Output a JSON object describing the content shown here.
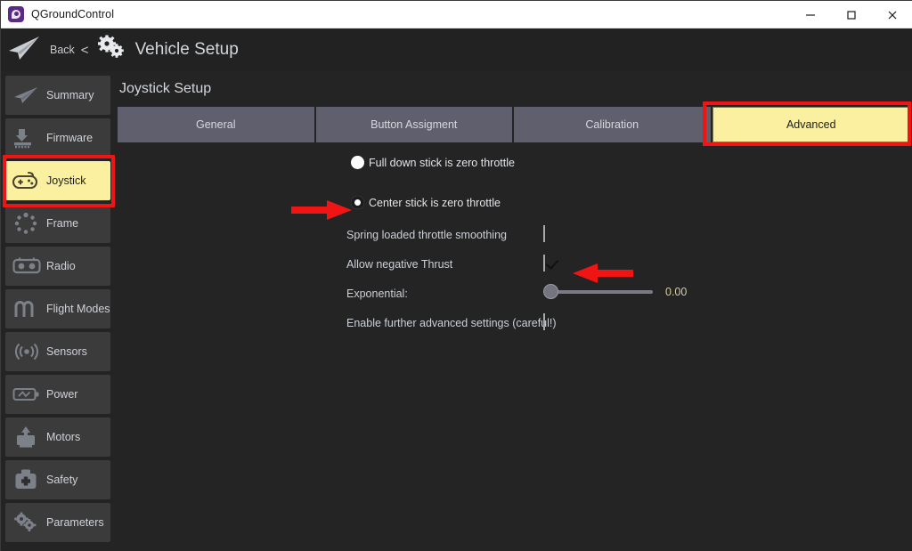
{
  "window": {
    "title": "QGroundControl",
    "logo_icon": "qgroundcontrol-logo-icon",
    "minimize_label": "minimize-icon",
    "maximize_label": "maximize-icon",
    "close_label": "close-icon"
  },
  "header": {
    "plane_icon": "paper-plane-icon",
    "back_label": "Back",
    "chevron": "<",
    "gears_icon": "gears-icon",
    "title": "Vehicle Setup"
  },
  "sidebar": {
    "items": [
      {
        "label": "Summary",
        "icon": "paper-plane-icon",
        "active": false
      },
      {
        "label": "Firmware",
        "icon": "download-chip-icon",
        "active": false
      },
      {
        "label": "Joystick",
        "icon": "gamepad-icon",
        "active": true
      },
      {
        "label": "Frame",
        "icon": "frame-dots-icon",
        "active": false
      },
      {
        "label": "Radio",
        "icon": "radio-controller-icon",
        "active": false
      },
      {
        "label": "Flight Modes",
        "icon": "waveform-icon",
        "active": false
      },
      {
        "label": "Sensors",
        "icon": "sensor-waves-icon",
        "active": false
      },
      {
        "label": "Power",
        "icon": "battery-icon",
        "active": false
      },
      {
        "label": "Motors",
        "icon": "motor-icon",
        "active": false
      },
      {
        "label": "Safety",
        "icon": "first-aid-kit-icon",
        "active": false
      },
      {
        "label": "Parameters",
        "icon": "gears-icon",
        "active": false
      }
    ]
  },
  "main": {
    "setup_title": "Joystick Setup",
    "tabs": [
      {
        "label": "General",
        "active": false
      },
      {
        "label": "Button Assigment",
        "active": false
      },
      {
        "label": "Calibration",
        "active": false
      },
      {
        "label": "Advanced",
        "active": true
      }
    ],
    "throttle_mode": {
      "options": [
        {
          "label": "Full down stick is zero throttle",
          "selected": false
        },
        {
          "label": "Center stick is zero throttle",
          "selected": true
        }
      ]
    },
    "settings": [
      {
        "label": "Spring loaded throttle smoothing",
        "checked": false
      },
      {
        "label": "Allow negative Thrust",
        "checked": true
      },
      {
        "label": "Enable further advanced settings (careful!)",
        "checked": false
      }
    ],
    "exponential": {
      "label": "Exponential:",
      "value": "0.00",
      "slider_percent": 0
    }
  },
  "annotations": {
    "highlight_color": "#f01515",
    "arrow_radio_name": "red-arrow-pointing-to-center-stick-radio",
    "arrow_checkbox_name": "red-arrow-pointing-to-allow-negative-thrust-checkbox",
    "box_sidebar_name": "red-highlight-box-joystick-sidebar-item",
    "box_tab_name": "red-highlight-box-advanced-tab"
  }
}
